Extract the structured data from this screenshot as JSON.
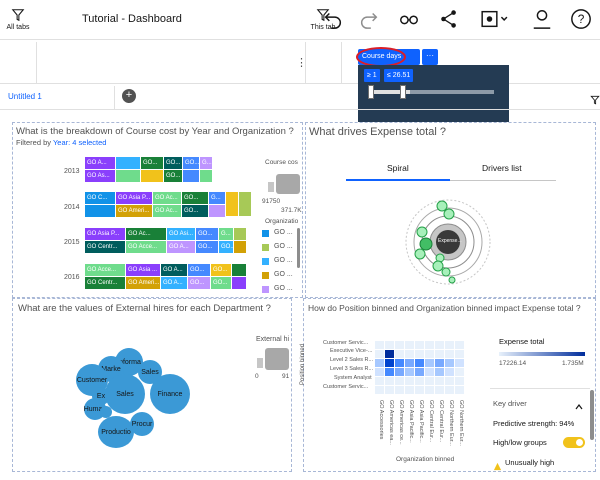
{
  "app": {
    "title": "Tutorial - Dashboard"
  },
  "toolbar": {
    "icons": [
      "undo-icon",
      "redo-icon",
      "glasses-icon",
      "share-icon",
      "view-icon",
      "user-icon",
      "help-icon"
    ]
  },
  "filterbar": {
    "all_tabs_label": "All tabs",
    "this_tab_label": "This tab",
    "active_filter": "Course days",
    "more_label": "···",
    "range_min": "≥ 1",
    "range_max": "≤ 26.51"
  },
  "tabs": [
    {
      "label": "Untitled 1"
    }
  ],
  "panel_tl": {
    "title": "What is the breakdown of Course cost by Year and Organization ?",
    "filtered_prefix": "Filtered by",
    "filtered_value": "Year: 4 selected",
    "years": [
      "2013",
      "2014",
      "2015",
      "2016"
    ],
    "rows": [
      [
        "GO A...",
        "",
        "GO...",
        "GO...",
        "GO...",
        "G..."
      ],
      [
        "GO As...",
        "",
        "",
        "GO...",
        "",
        ""
      ],
      [
        "GO C...",
        "GO Asia P...",
        "GO Ac...",
        "GO...",
        "G...",
        ""
      ],
      [
        "",
        "GO Ameri...",
        "GO Ac...",
        "GO...",
        "",
        ""
      ],
      [
        "GO Asia P...",
        "GO Ac...",
        "GO Asi...",
        "GO...",
        "G...",
        ""
      ],
      [
        "GO Centr...",
        "GO Acce...",
        "GO A...",
        "GO...",
        "GO...",
        ""
      ],
      [
        "GO Acce...",
        "GO Asia ...",
        "GO A...",
        "GO...",
        "GO...",
        ""
      ],
      [
        "GO Centr...",
        "GO Ameri...",
        "GO A...",
        "GO...",
        "GO...",
        ""
      ]
    ],
    "size_legend_title": "Course cos",
    "size_min": "91750",
    "size_max": "371.7K",
    "color_legend_title": "Organizatio",
    "color_legend_items": [
      "GO ...",
      "GO ...",
      "GO ...",
      "GO ...",
      "GO ..."
    ],
    "colors": {
      "purple": "#8a3ffc",
      "teal": "#33b1ff",
      "green": "#6fdc8c",
      "darkgreen": "#198038",
      "lime": "#a7c957",
      "yellow": "#f1c21b",
      "orange": "#d2a106",
      "blue": "#4589ff",
      "gray": "#8d8d8d",
      "lavender": "#be95ff"
    }
  },
  "panel_tr": {
    "title": "What drives Expense total ?",
    "tabs": [
      "Spiral",
      "Drivers list"
    ],
    "center_label": "Expense..."
  },
  "panel_bl": {
    "title": "What are the values of External hires for each Department ?",
    "bubbles": [
      "Informa",
      "Marke",
      "Sales",
      "Customer",
      "Ex",
      "Sales",
      "Finance",
      "Human",
      "Procur",
      "Productio"
    ],
    "legend_title": "External hi",
    "legend_min": "0",
    "legend_max": "91"
  },
  "panel_br": {
    "title": "How do Position binned and Organization binned impact Expense total ?",
    "y_label": "Position binned",
    "x_label": "Organization binned",
    "y_ticks": [
      "Customer Servic...",
      "Executive Vice-...",
      "Level 2 Sales R...",
      "Level 3 Sales R...",
      "System Analyst",
      "Customer Servic..."
    ],
    "x_ticks": [
      "GO Accessories",
      "GO Americas ea...",
      "GO Americas ce...",
      "GO Asia Pacific...",
      "GO Asia Pacific...",
      "GO Central Eur...",
      "GO Central Eur...",
      "GO Northern Eur...",
      "GO Northern Eur..."
    ],
    "legend_title": "Expense total",
    "legend_min": "17226.14",
    "legend_max": "1.735M",
    "key_driver_label": "Key driver",
    "predictive_strength": "Predictive strength: 94%",
    "high_low_label": "High/low groups",
    "unusually_high": "Unusually high"
  }
}
